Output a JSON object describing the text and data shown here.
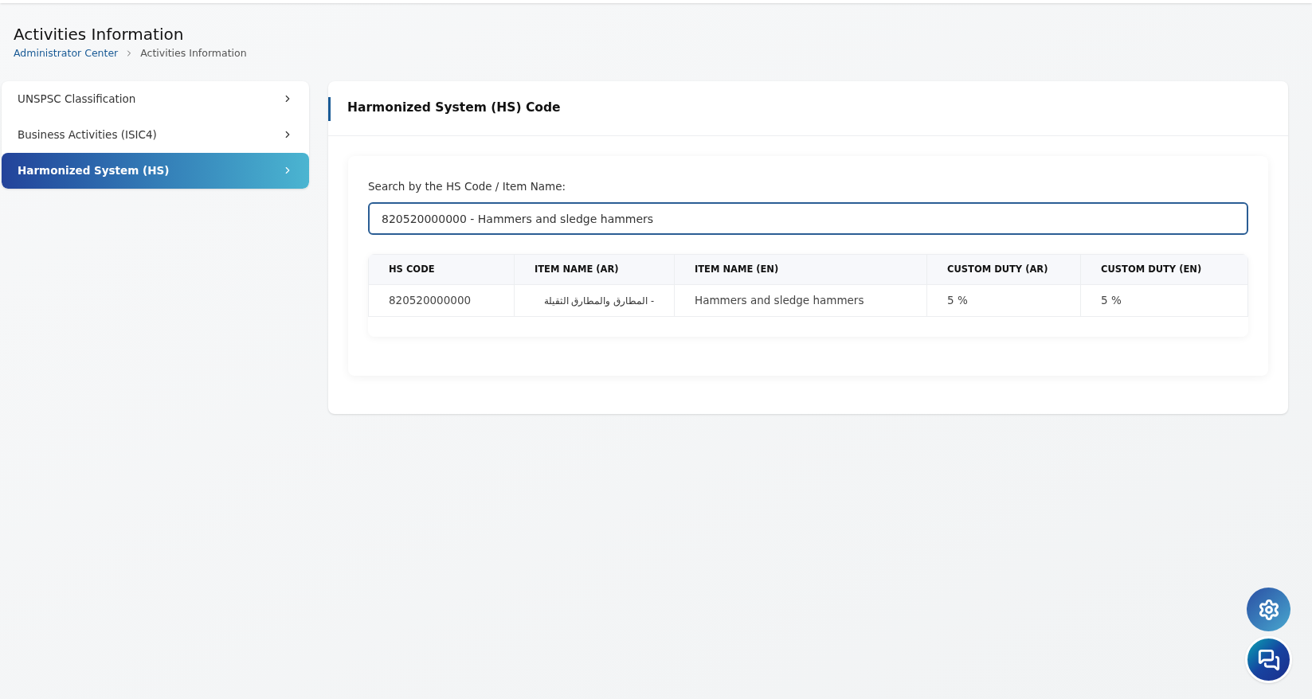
{
  "page": {
    "title": "Activities Information",
    "breadcrumb": [
      {
        "label": "Administrator Center",
        "kind": "link"
      },
      {
        "label": "Activities Information",
        "kind": "current"
      }
    ]
  },
  "sidebar": {
    "items": [
      {
        "label": "UNSPSC Classification",
        "selected": false
      },
      {
        "label": "Business Activities (ISIC4)",
        "selected": false
      },
      {
        "label": "Harmonized System (HS)",
        "selected": true
      }
    ]
  },
  "panel": {
    "title": "Harmonized System (HS) Code",
    "search": {
      "label": "Search by the HS Code / Item Name:",
      "value": "820520000000 - Hammers and sledge hammers"
    },
    "table": {
      "columns": [
        "HS CODE",
        "ITEM NAME (AR)",
        "ITEM NAME (EN)",
        "CUSTOM DUTY (AR)",
        "CUSTOM DUTY (EN)"
      ],
      "rows": [
        [
          "820520000000",
          "- المطارق والمطارق الثقيلة",
          "Hammers and sledge hammers",
          "5 %",
          "5 %"
        ]
      ]
    }
  }
}
